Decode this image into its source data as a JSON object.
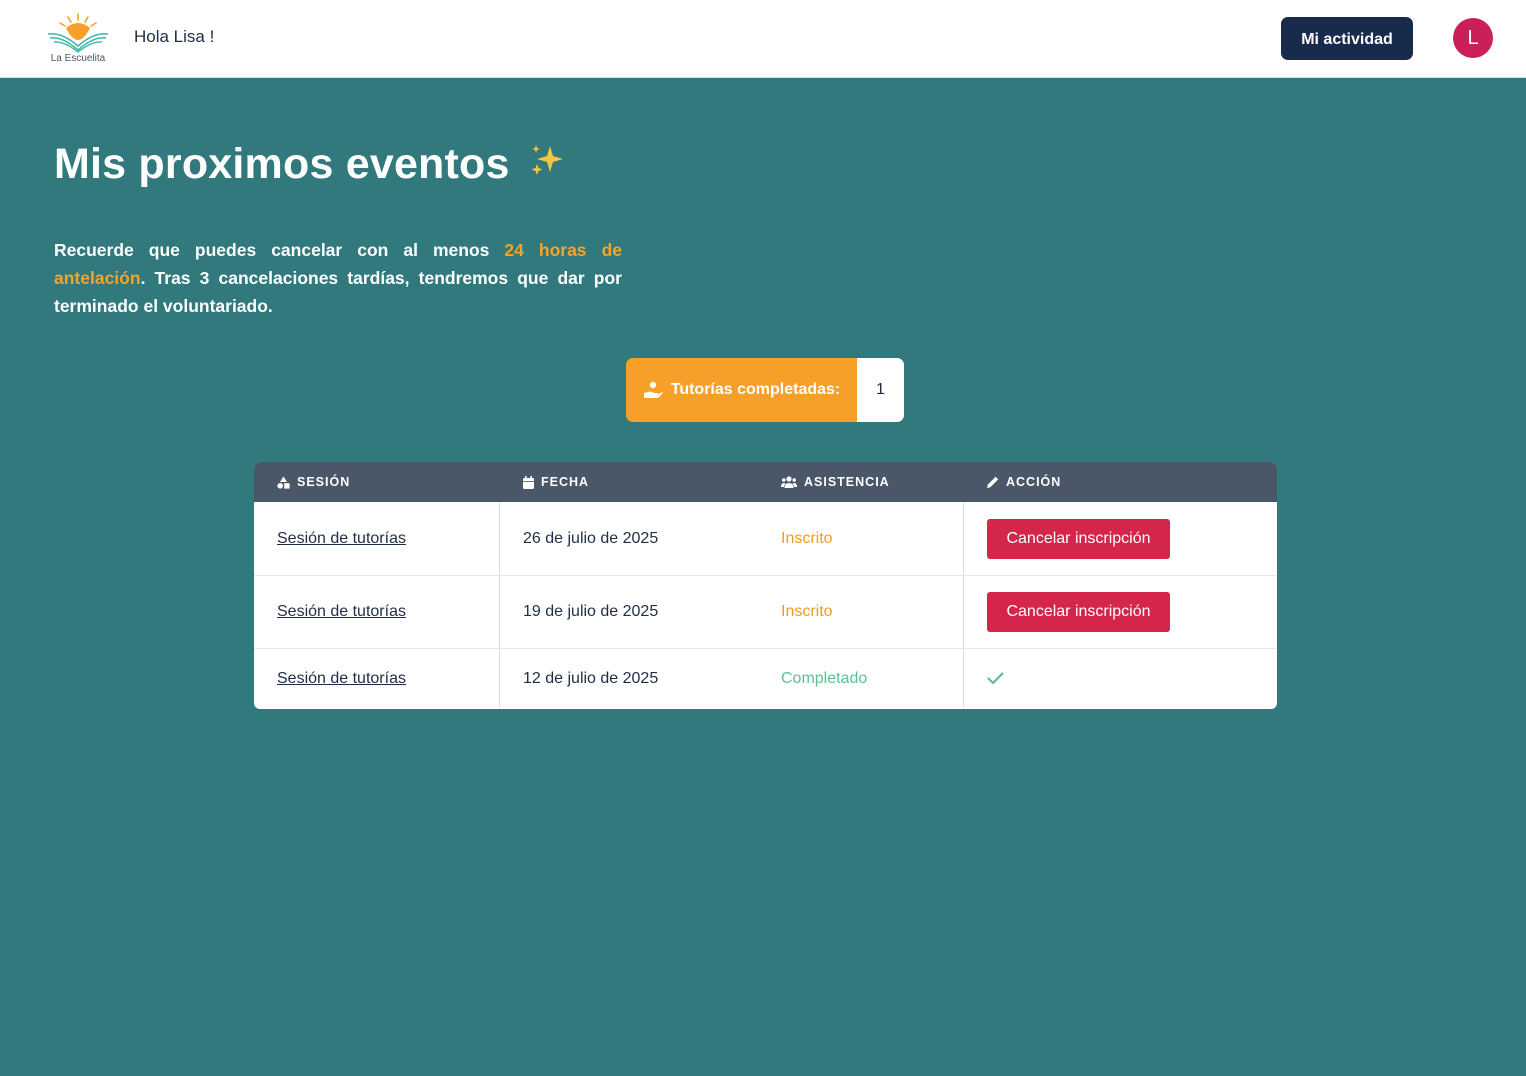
{
  "header": {
    "logo_text": "La Escuelita",
    "greeting": "Hola Lisa !",
    "activity_button": "Mi actividad",
    "avatar_initial": "L",
    "avatar_color": "#cc1f5a"
  },
  "main": {
    "title": "Mis proximos eventos",
    "note_part1": "Recuerde que puedes cancelar con al menos ",
    "note_highlight": "24 horas de antelación",
    "note_part2": ". Tras 3 cancelaciones tardías, tendremos que dar por terminado el voluntariado.",
    "counter_label": "Tutorías completadas:",
    "counter_value": "1"
  },
  "table": {
    "headers": [
      "SESIÓN",
      "FECHA",
      "ASISTENCIA",
      "ACCIÓN"
    ],
    "rows": [
      {
        "session": "Sesión de tutorías",
        "date": "26 de julio de 2025",
        "status": "Inscrito",
        "action": "Cancelar inscripción"
      },
      {
        "session": "Sesión de tutorías",
        "date": "19 de julio de 2025",
        "status": "Inscrito",
        "action": "Cancelar inscripción"
      },
      {
        "session": "Sesión de tutorías",
        "date": "12 de julio de 2025",
        "status": "Completado",
        "action": ""
      }
    ]
  },
  "colors": {
    "background": "#31797c",
    "accent_orange": "#f6a02a",
    "cancel_red": "#d4254a",
    "completed_green": "#5cc192",
    "navy": "#192b4c"
  },
  "icons": {
    "session_header": "shapes-icon",
    "date_header": "calendar-icon",
    "attendance_header": "users-icon",
    "action_header": "pencil-icon",
    "counter": "hand-holding-heart-icon",
    "completed_action": "check-icon",
    "title": "sparkles-icon"
  }
}
